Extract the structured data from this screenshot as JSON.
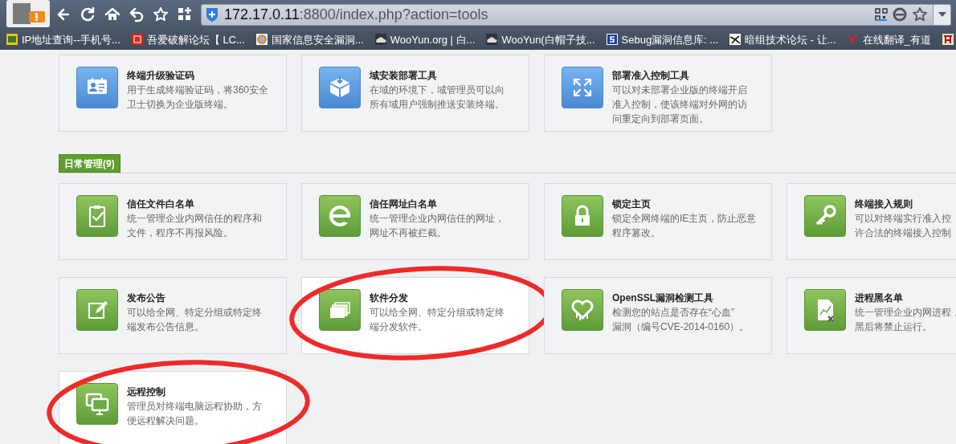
{
  "browser": {
    "url_host": "172.17.0.11",
    "url_rest": ":8800/index.php?action=tools",
    "bookmarks": [
      {
        "label": "IP地址查询--手机号..."
      },
      {
        "label": "吾爱破解论坛【 LC..."
      },
      {
        "label": "国家信息安全漏洞..."
      },
      {
        "label": "WooYun.org | 白..."
      },
      {
        "label": "WooYun(白帽子技..."
      },
      {
        "label": "Sebug漏洞信息库: ..."
      },
      {
        "label": "暗组技术论坛 - 让..."
      },
      {
        "label": "在线翻译_有道"
      }
    ]
  },
  "sections": [
    {
      "kind": "deploy",
      "cards": [
        {
          "title": "终端升级验证码",
          "lines": [
            "用于生成终端验证码，将360安全",
            "卫士切换为企业版终端。"
          ],
          "highlighted": false
        },
        {
          "title": "域安装部署工具",
          "lines": [
            "在域的环境下，域管理员可以向",
            "所有域用户强制推送安装终端。"
          ],
          "highlighted": false
        },
        {
          "title": "部署准入控制工具",
          "lines": [
            "可以对未部署企业版的终端开启",
            "准入控制，使该终端对外网的访",
            "问重定向到部署页面。"
          ],
          "highlighted": false
        }
      ]
    },
    {
      "kind": "daily",
      "title": "日常管理(9)",
      "cards": [
        {
          "title": "信任文件白名单",
          "lines": [
            "统一管理企业内网信任的程序和",
            "文件，程序不再报风险。"
          ],
          "highlighted": false
        },
        {
          "title": "信任网址白名单",
          "lines": [
            "统一管理企业内网信任的网址，",
            "网址不再被拦截。"
          ],
          "highlighted": false
        },
        {
          "title": "锁定主页",
          "lines": [
            "锁定全网终端的IE主页，防止恶意",
            "程序篡改。"
          ],
          "highlighted": false
        },
        {
          "title": "终端接入规则",
          "lines": [
            "可以对终端实行准入控",
            "许合法的终端接入控制"
          ],
          "highlighted": false
        },
        {
          "title": "发布公告",
          "lines": [
            "可以给全网、特定分组或特定终",
            "端发布公告信息。"
          ],
          "highlighted": false
        },
        {
          "title": "软件分发",
          "lines": [
            "可以给全网、特定分组或特定终",
            "端分发软件。"
          ],
          "highlighted": true
        },
        {
          "title": "OpenSSL漏洞检测工具",
          "lines": [
            "检测您的站点是否存在“心血”",
            "漏洞（编号CVE-2014-0160）。"
          ],
          "highlighted": false
        },
        {
          "title": "进程黑名单",
          "lines": [
            "统一管理企业内网进程，",
            "黑后将禁止运行。"
          ],
          "highlighted": false
        },
        {
          "title": "远程控制",
          "lines": [
            "管理员对终端电脑远程协助，方",
            "便远程解决问题。"
          ],
          "highlighted": true
        }
      ]
    }
  ]
}
